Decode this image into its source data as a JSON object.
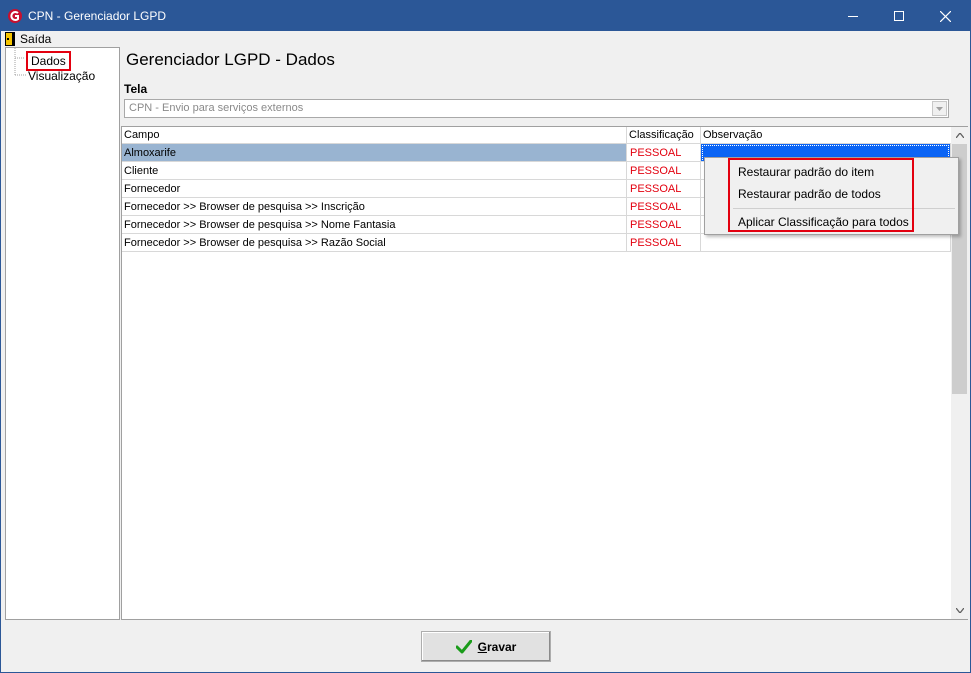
{
  "window": {
    "title": "CPN - Gerenciador LGPD"
  },
  "menu": {
    "exit_label": "Saída"
  },
  "tree": {
    "items": [
      {
        "label": "Dados"
      },
      {
        "label": "Visualização"
      }
    ]
  },
  "page": {
    "title": "Gerenciador LGPD - Dados"
  },
  "tela": {
    "label": "Tela",
    "value": "CPN - Envio para serviços externos"
  },
  "grid": {
    "columns": [
      "Campo",
      "Classificação",
      "Observação"
    ],
    "rows": [
      {
        "campo": "Almoxarife",
        "classificacao": "PESSOAL",
        "observacao": ""
      },
      {
        "campo": "Cliente",
        "classificacao": "PESSOAL",
        "observacao": ""
      },
      {
        "campo": "Fornecedor",
        "classificacao": "PESSOAL",
        "observacao": ""
      },
      {
        "campo": "Fornecedor >> Browser de pesquisa >> Inscrição",
        "classificacao": "PESSOAL",
        "observacao": ""
      },
      {
        "campo": "Fornecedor >> Browser de pesquisa >> Nome Fantasia",
        "classificacao": "PESSOAL",
        "observacao": ""
      },
      {
        "campo": "Fornecedor >> Browser de pesquisa >> Razão Social",
        "classificacao": "PESSOAL",
        "observacao": ""
      }
    ],
    "selected_row": 0
  },
  "context_menu": {
    "items": [
      "Restaurar padrão do item",
      "Restaurar padrão de todos",
      "Aplicar Classificação para todos"
    ]
  },
  "footer": {
    "save_first": "G",
    "save_rest": "ravar"
  },
  "colors": {
    "titlebar": "#2b5797",
    "classification_text": "#e3000f",
    "highlight_box": "#e3000f",
    "selected_row": "#99b4d1",
    "selected_cell": "#0a64f5"
  }
}
